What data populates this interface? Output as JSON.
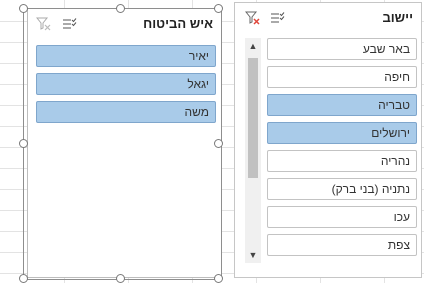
{
  "slicer_yishuv": {
    "title": "יישוב",
    "items": [
      {
        "label": "באר שבע",
        "selected": false
      },
      {
        "label": "חיפה",
        "selected": false
      },
      {
        "label": "טבריה",
        "selected": true
      },
      {
        "label": "ירושלים",
        "selected": true
      },
      {
        "label": "נהריה",
        "selected": false
      },
      {
        "label": "נתניה (בני ברק)",
        "selected": false
      },
      {
        "label": "עכו",
        "selected": false
      },
      {
        "label": "צפת",
        "selected": false
      }
    ],
    "icons": {
      "multiselect": "multi-select-icon",
      "clear_filter": "clear-filter-icon"
    }
  },
  "slicer_agent": {
    "title": "איש הביטוח",
    "items": [
      {
        "label": "יאיר",
        "selected": true
      },
      {
        "label": "יגאל",
        "selected": true
      },
      {
        "label": "משה",
        "selected": true
      }
    ],
    "icons": {
      "multiselect": "multi-select-icon",
      "clear_filter": "clear-filter-icon"
    }
  },
  "colors": {
    "selected_item": "#a9cbe9",
    "clear_filter_red": "#e0463b"
  }
}
